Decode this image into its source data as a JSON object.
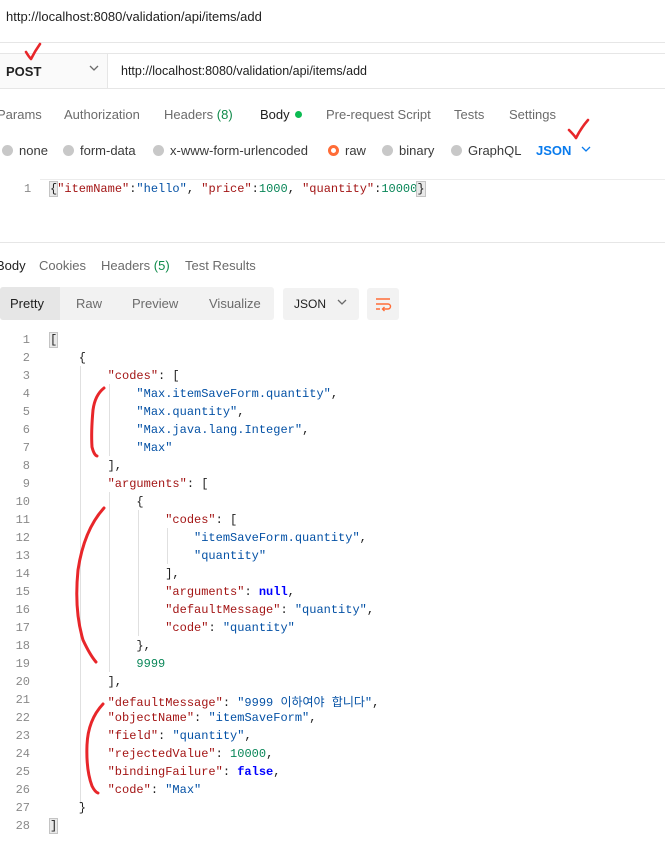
{
  "request_title": "http://localhost:8080/validation/api/items/add",
  "method": "POST",
  "url": "http://localhost:8080/validation/api/items/add",
  "request_tabs": [
    {
      "label": "Params"
    },
    {
      "label": "Authorization"
    },
    {
      "label": "Headers",
      "count": "(8)"
    },
    {
      "label": "Body"
    },
    {
      "label": "Pre-request Script"
    },
    {
      "label": "Tests"
    },
    {
      "label": "Settings"
    }
  ],
  "body_types": [
    {
      "label": "none"
    },
    {
      "label": "form-data"
    },
    {
      "label": "x-www-form-urlencoded"
    },
    {
      "label": "raw"
    },
    {
      "label": "binary"
    },
    {
      "label": "GraphQL"
    }
  ],
  "body_format": "JSON",
  "request_body": {
    "line_number": "1",
    "brace_open": "{",
    "k1": "\"itemName\"",
    "v1": "\"hello\"",
    "k2": "\"price\"",
    "v2": "1000",
    "k3": "\"quantity\"",
    "v3": "10000",
    "brace_close": "}"
  },
  "response_tabs": [
    {
      "label": "Body"
    },
    {
      "label": "Cookies"
    },
    {
      "label": "Headers",
      "count": "(5)"
    },
    {
      "label": "Test Results"
    }
  ],
  "view_modes": [
    "Pretty",
    "Raw",
    "Preview",
    "Visualize"
  ],
  "response_format": "JSON",
  "response": {
    "line_numbers": [
      "1",
      "2",
      "3",
      "4",
      "5",
      "6",
      "7",
      "8",
      "9",
      "10",
      "11",
      "12",
      "13",
      "14",
      "15",
      "16",
      "17",
      "18",
      "19",
      "20",
      "21",
      "22",
      "23",
      "24",
      "25",
      "26",
      "27",
      "28"
    ],
    "codes_key": "\"codes\"",
    "code_1": "\"Max.itemSaveForm.quantity\"",
    "code_2": "\"Max.quantity\"",
    "code_3": "\"Max.java.lang.Integer\"",
    "code_4": "\"Max\"",
    "arguments_key": "\"arguments\"",
    "inner_codes_key": "\"codes\"",
    "inner_code_1": "\"itemSaveForm.quantity\"",
    "inner_code_2": "\"quantity\"",
    "inner_arguments_key": "\"arguments\"",
    "inner_arguments_value": "null",
    "inner_default_message_key": "\"defaultMessage\"",
    "inner_default_message_value": "\"quantity\"",
    "inner_code_key": "\"code\"",
    "inner_code_value": "\"quantity\"",
    "argument_number": "9999",
    "default_message_key": "\"defaultMessage\"",
    "default_message_value": "\"9999 이하여야 합니다\"",
    "object_name_key": "\"objectName\"",
    "object_name_value": "\"itemSaveForm\"",
    "field_key": "\"field\"",
    "field_value": "\"quantity\"",
    "rejected_value_key": "\"rejectedValue\"",
    "rejected_value_value": "10000",
    "binding_failure_key": "\"bindingFailure\"",
    "binding_failure_value": "false",
    "code_key": "\"code\"",
    "code_value": "\"Max\""
  },
  "colors": {
    "key": "#a31515",
    "string": "#0451a5",
    "number": "#098658",
    "keyword": "#0000ff",
    "accent": "#ff6c37",
    "link": "#097bed",
    "annotation": "#e8262a"
  }
}
